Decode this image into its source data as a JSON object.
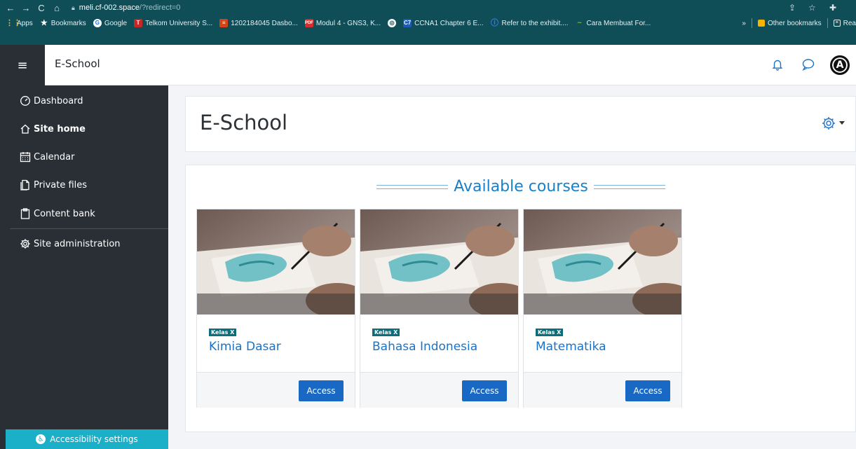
{
  "browser": {
    "url_host": "meli.cf-002.space",
    "url_path": "/?redirect=0",
    "bookmarks": [
      {
        "label": "Apps",
        "icon": "apps-grid-icon",
        "color": "#e8b43a"
      },
      {
        "label": "Bookmarks",
        "icon": "star-icon",
        "color": "#ffffff"
      },
      {
        "label": "Google",
        "icon": "google-icon",
        "color": "#ffffff"
      },
      {
        "label": "Telkom University S...",
        "icon": "telkom-icon",
        "color": "#c62828"
      },
      {
        "label": "1202184045 Dasbo...",
        "icon": "dashboard-icon",
        "color": "#d84315"
      },
      {
        "label": "Modul 4 - GNS3, K...",
        "icon": "pdf-icon",
        "color": "#d32f2f"
      },
      {
        "label": "",
        "icon": "globe-icon",
        "color": "#ffffff"
      },
      {
        "label": "CCNA1 Chapter 6 E...",
        "icon": "c7-icon",
        "color": "#1e5bb8"
      },
      {
        "label": "Refer to the exhibit....",
        "icon": "info-icon",
        "color": "#3b82f6"
      },
      {
        "label": "Cara Membuat For...",
        "icon": "wave-icon",
        "color": "#7cb342"
      }
    ],
    "more": "»",
    "other_bookmarks": "Other bookmarks",
    "reading_list": "Rea"
  },
  "navbar": {
    "brand": "E-School",
    "avatar_letter": "A"
  },
  "sidebar": {
    "items": [
      {
        "label": "Dashboard",
        "icon": "dashboard-gauge-icon"
      },
      {
        "label": "Site home",
        "icon": "home-icon"
      },
      {
        "label": "Calendar",
        "icon": "calendar-icon"
      },
      {
        "label": "Private files",
        "icon": "files-icon"
      },
      {
        "label": "Content bank",
        "icon": "clipboard-icon"
      },
      {
        "label": "Site administration",
        "icon": "gear-icon"
      }
    ],
    "accessibility": "Accessibility settings"
  },
  "page": {
    "title": "E-School",
    "section_title": "Available courses"
  },
  "courses": [
    {
      "category": "Kelas X",
      "name": "Kimia Dasar",
      "action": "Access"
    },
    {
      "category": "Kelas X",
      "name": "Bahasa Indonesia",
      "action": "Access"
    },
    {
      "category": "Kelas X",
      "name": "Matematika",
      "action": "Access"
    }
  ],
  "colors": {
    "chrome": "#0f4d57",
    "sidebar": "#2a2f36",
    "accent": "#1a73c9",
    "button": "#1868c4",
    "badge": "#0c6e7a",
    "accessibility": "#1bb0c8"
  }
}
